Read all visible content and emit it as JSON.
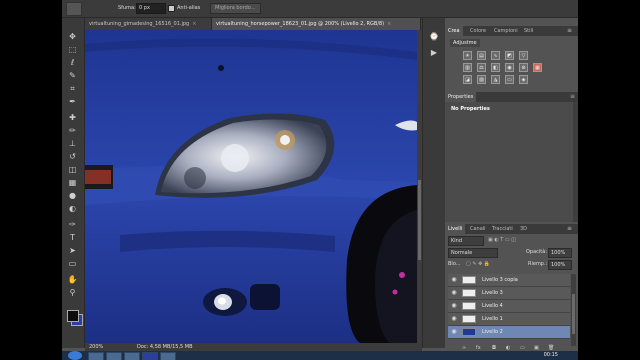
{
  "options_bar": {
    "sfuma_label": "Sfuma:",
    "sfuma_value": "0 px",
    "antialias_label": "Anti-alias",
    "refine_button": "Migliora bordo..."
  },
  "document_tabs": [
    {
      "label": "virtualtuning_gimadesing_16516_01.jpg",
      "close": "×"
    },
    {
      "label": "virtualtuning_horsepower_18623_01.jpg @ 200% (Livello 2, RGB/8)",
      "close": "×"
    }
  ],
  "status_bar": {
    "zoom": "200%",
    "doc": "Doc: 4,58 MB/15,5 MB"
  },
  "panels": {
    "top_tabs": [
      "Crea",
      "Colore",
      "Campioni",
      "Stili"
    ],
    "adjustments_label": "Adjustme",
    "properties_tab": "Properties",
    "properties_message": "No Properties",
    "layers_tabs": [
      "Livelli",
      "Canali",
      "Tracciati",
      "3D"
    ],
    "kind_label": "Kind",
    "blend_mode": "Normale",
    "opacity_label": "Opacità:",
    "opacity_value": "100%",
    "lock_label": "Blo...",
    "fill_label": "Riemp.:",
    "fill_value": "100%"
  },
  "layers": [
    {
      "name": "Livello 3 copia",
      "selected": false
    },
    {
      "name": "Livello 3",
      "selected": false
    },
    {
      "name": "Livello 4",
      "selected": false
    },
    {
      "name": "Livello 1",
      "selected": false
    },
    {
      "name": "Livello 2",
      "selected": true
    }
  ],
  "colors": {
    "foreground": "#0d0d0d",
    "background": "#2a40a5",
    "ui_dark": "#535353",
    "layer_selected": "#6e87b3",
    "car_body": "#223a98"
  },
  "taskbar": {
    "clock": "00:15"
  }
}
